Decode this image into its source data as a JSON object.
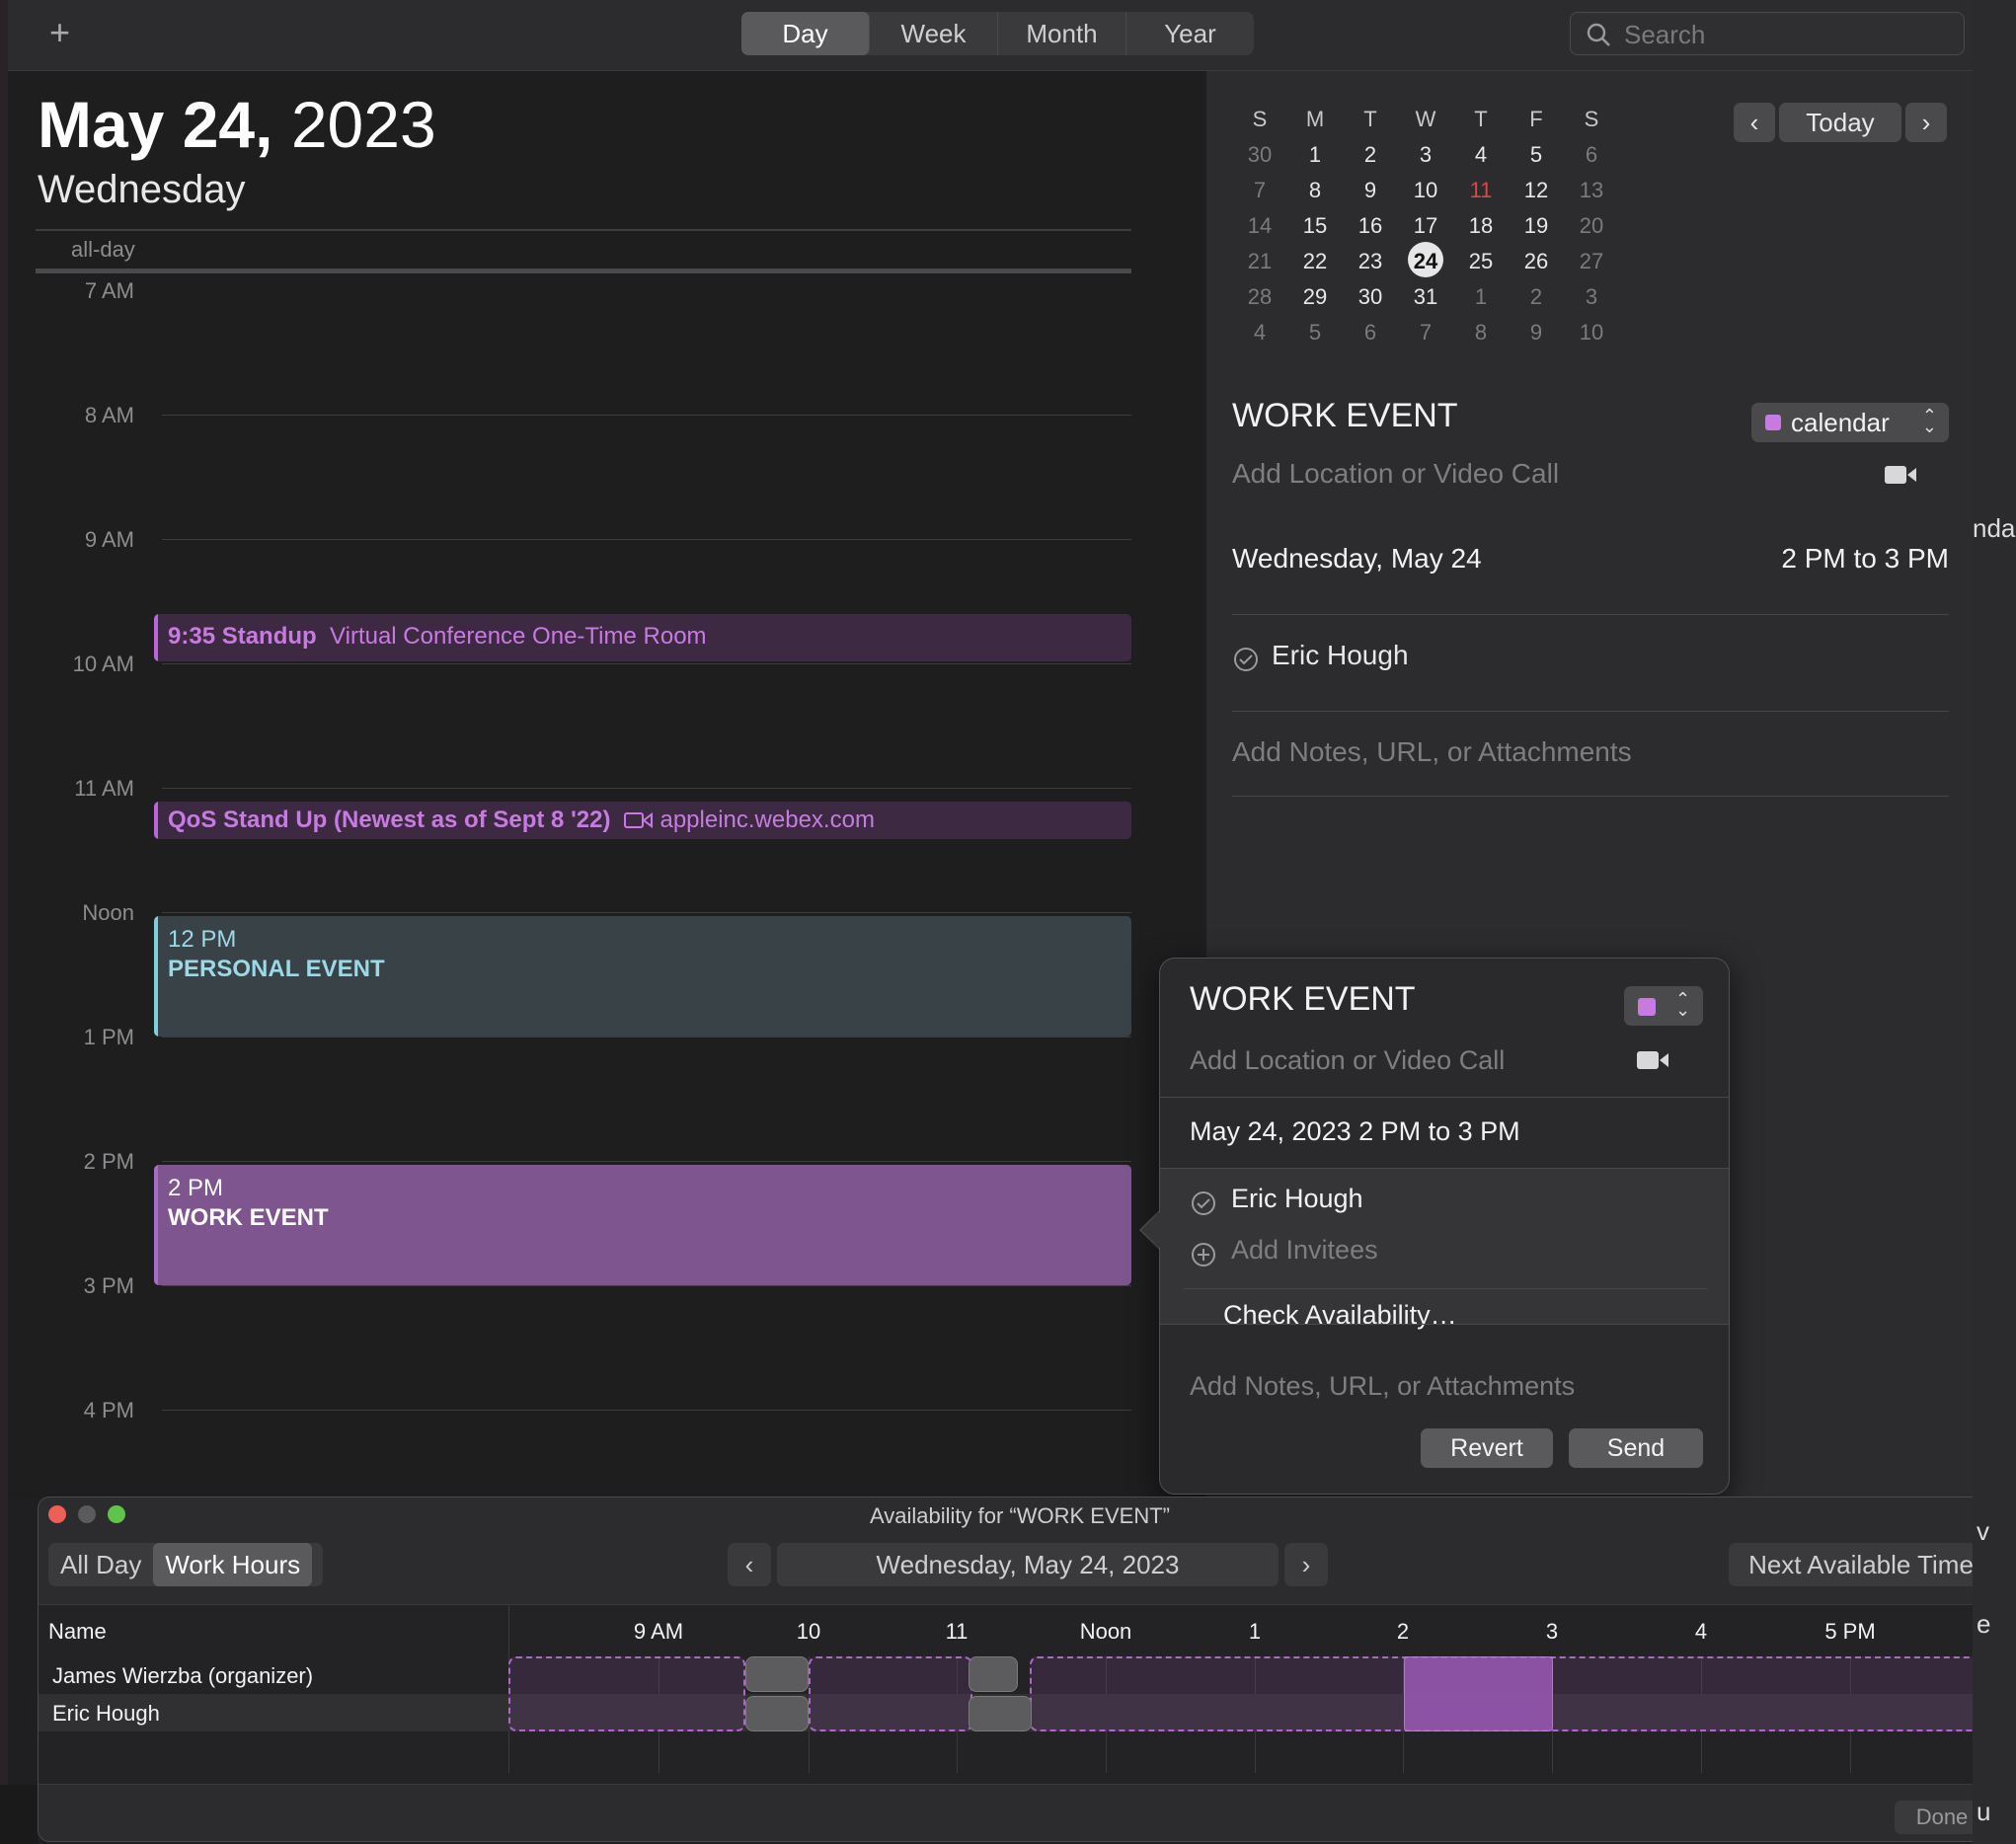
{
  "toolbar": {
    "add_label": "+",
    "views": [
      "Day",
      "Week",
      "Month",
      "Year"
    ],
    "active_view": "Day",
    "search_placeholder": "Search"
  },
  "day_view": {
    "date_bold": "May 24,",
    "year": "2023",
    "weekday": "Wednesday",
    "allday_label": "all-day",
    "hours": [
      "7 AM",
      "8 AM",
      "9 AM",
      "10 AM",
      "11 AM",
      "Noon",
      "1 PM",
      "2 PM",
      "3 PM",
      "4 PM"
    ],
    "events": [
      {
        "title": "9:35 Standup",
        "location": "Virtual Conference One-Time Room"
      },
      {
        "title": "QoS Stand Up (Newest as of Sept 8 '22)",
        "location": "appleinc.webex.com"
      },
      {
        "time": "12 PM",
        "title": "PERSONAL EVENT"
      },
      {
        "time": "2 PM",
        "title": "WORK EVENT"
      }
    ]
  },
  "mini_calendar": {
    "weekday_headers": [
      "S",
      "M",
      "T",
      "W",
      "T",
      "F",
      "S"
    ],
    "weeks": [
      [
        "30",
        "1",
        "2",
        "3",
        "4",
        "5",
        "6"
      ],
      [
        "7",
        "8",
        "9",
        "10",
        "11",
        "12",
        "13"
      ],
      [
        "14",
        "15",
        "16",
        "17",
        "18",
        "19",
        "20"
      ],
      [
        "21",
        "22",
        "23",
        "24",
        "25",
        "26",
        "27"
      ],
      [
        "28",
        "29",
        "30",
        "31",
        "1",
        "2",
        "3"
      ],
      [
        "4",
        "5",
        "6",
        "7",
        "8",
        "9",
        "10"
      ]
    ],
    "selected_day": "24",
    "today_day": "11",
    "today_button": "Today"
  },
  "inspector": {
    "title": "WORK EVENT",
    "calendar_name": "calendar",
    "calendar_color": "#c77be0",
    "location_placeholder": "Add Location or Video Call",
    "date": "Wednesday, May 24",
    "time": "2 PM to 3 PM",
    "attendee": "Eric Hough",
    "notes_placeholder": "Add Notes, URL, or Attachments"
  },
  "popover": {
    "title": "WORK EVENT",
    "location_placeholder": "Add Location or Video Call",
    "datetime": "May 24, 2023  2 PM to 3 PM",
    "attendee": "Eric Hough",
    "invitees_placeholder": "Add Invitees",
    "check_availability": "Check Availability…",
    "notes_placeholder": "Add Notes, URL, or Attachments",
    "revert": "Revert",
    "send": "Send"
  },
  "availability": {
    "window_title": "Availability for “WORK EVENT”",
    "modes": [
      "All Day",
      "Work Hours"
    ],
    "active_mode": "Work Hours",
    "date": "Wednesday, May 24, 2023",
    "next_available": "Next Available Time",
    "name_header": "Name",
    "time_labels": [
      "9 AM",
      "10",
      "11",
      "Noon",
      "1",
      "2",
      "3",
      "4",
      "5 PM"
    ],
    "people": [
      "James Wierzba (organizer)",
      "Eric Hough"
    ],
    "done": "Done"
  },
  "edge": {
    "right_text_1": "nda",
    "right_text_2": "e",
    "right_text_3": "v",
    "right_text_4": "u"
  },
  "colors": {
    "accent_purple": "#c77be0",
    "work_event": "#7f5590",
    "personal_event": "#394247",
    "today_red": "#e0463d"
  }
}
